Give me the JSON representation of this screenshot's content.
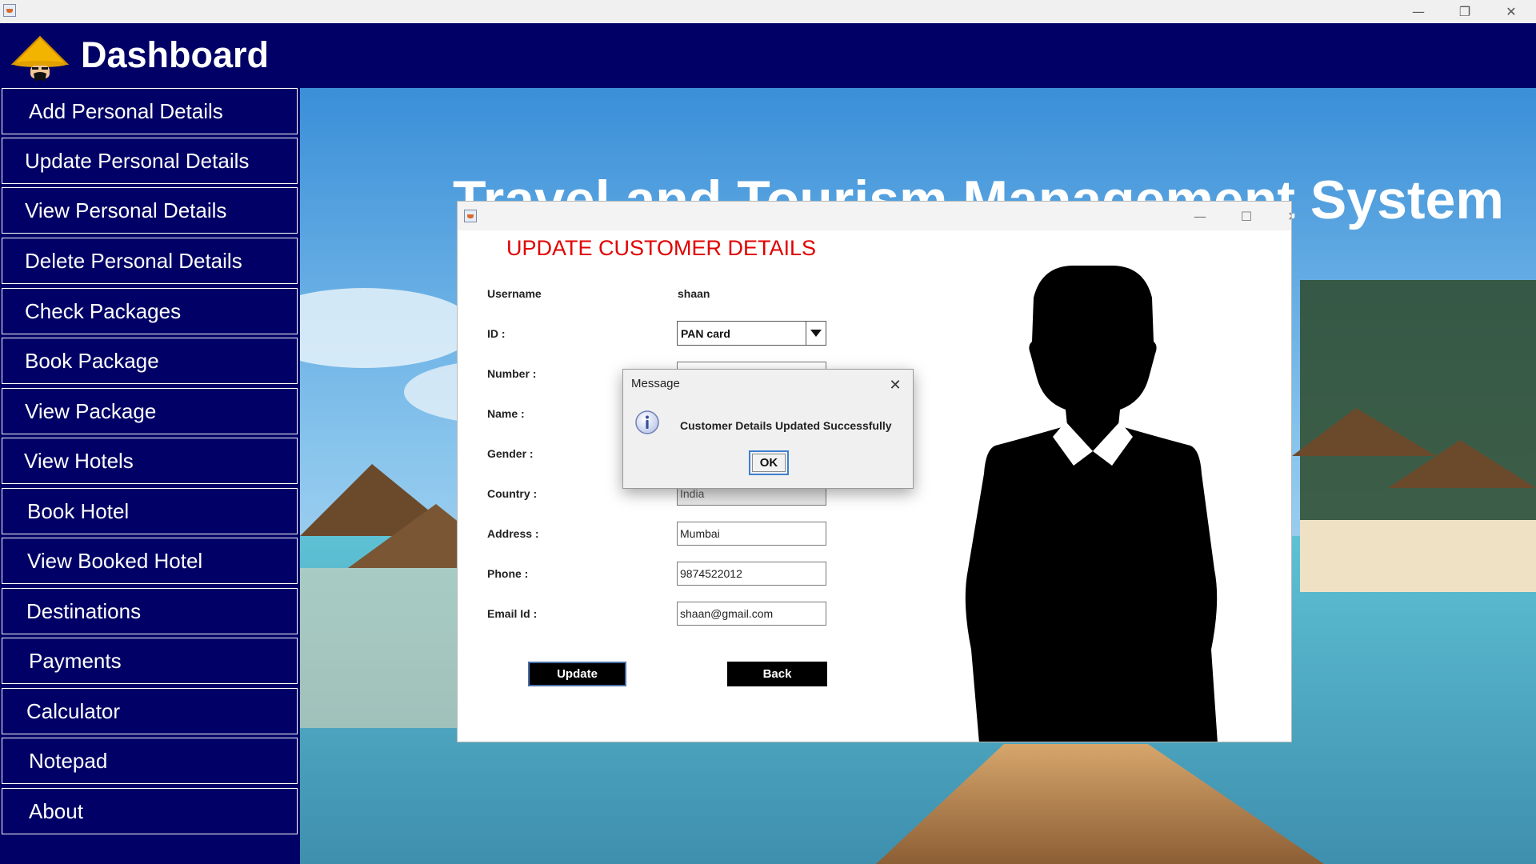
{
  "os_bar": {
    "minimize_glyph": "—",
    "restore_glyph": "❐",
    "close_glyph": "✕"
  },
  "header": {
    "title": "Dashboard",
    "logo_icon": "straw-hat-traveler-icon"
  },
  "sidebar": {
    "items": [
      {
        "label": "Add Personal Details"
      },
      {
        "label": "Update Personal Details"
      },
      {
        "label": "View Personal Details"
      },
      {
        "label": "Delete Personal Details"
      },
      {
        "label": "Check Packages"
      },
      {
        "label": "Book Package"
      },
      {
        "label": "View Package"
      },
      {
        "label": "View Hotels"
      },
      {
        "label": "Book Hotel"
      },
      {
        "label": "View Booked Hotel"
      },
      {
        "label": "Destinations"
      },
      {
        "label": "Payments"
      },
      {
        "label": "Calculator"
      },
      {
        "label": "Notepad"
      },
      {
        "label": "About"
      }
    ]
  },
  "scene": {
    "title": "Travel and Tourism Management System"
  },
  "window": {
    "heading": "UPDATE CUSTOMER DETAILS",
    "minimize_glyph": "—",
    "maximize_glyph": "☐",
    "close_glyph": "✕",
    "fields": {
      "username_label": "Username",
      "username_value": "shaan",
      "id_label": "ID :",
      "id_value": "PAN card",
      "number_label": "Number :",
      "name_label": "Name :",
      "gender_label": "Gender :",
      "country_label": "Country :",
      "country_value": "India",
      "address_label": "Address :",
      "address_value": "Mumbai",
      "phone_label": "Phone :",
      "phone_value": "9874522012",
      "email_label": "Email Id :",
      "email_value": "shaan@gmail.com"
    },
    "buttons": {
      "update": "Update",
      "back": "Back"
    }
  },
  "dialog": {
    "title": "Message",
    "message": "Customer Details Updated Successfully",
    "ok": "OK",
    "close_glyph": "✕",
    "icon": "info-icon"
  },
  "colors": {
    "navy": "#000066",
    "heading_red": "#e00000",
    "ok_focus": "#3d7fd1"
  }
}
